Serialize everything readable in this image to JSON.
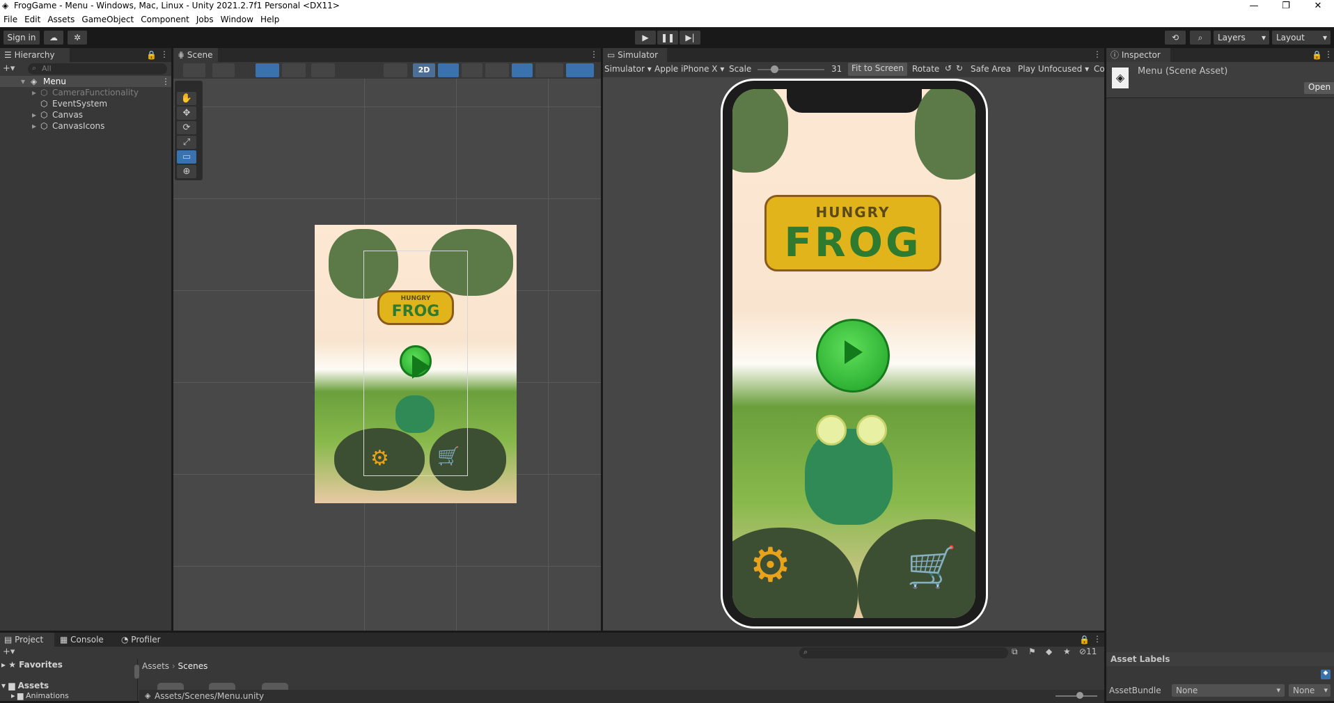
{
  "window": {
    "title": "FrogGame - Menu - Windows, Mac, Linux - Unity 2021.2.7f1 Personal <DX11>",
    "minimize": "—",
    "maximize": "❐",
    "close": "✕"
  },
  "menu": [
    "File",
    "Edit",
    "Assets",
    "GameObject",
    "Component",
    "Jobs",
    "Window",
    "Help"
  ],
  "toolbar": {
    "sign_in": "Sign in",
    "layers": "Layers",
    "layout": "Layout"
  },
  "hierarchy": {
    "tab": "Hierarchy",
    "search_placeholder": "All",
    "scene": "Menu",
    "items": [
      "CameraFunctionality",
      "EventSystem",
      "Canvas",
      "CanvasIcons"
    ]
  },
  "scene": {
    "tab": "Scene",
    "mode_2d": "2D"
  },
  "simulator": {
    "tab": "Simulator",
    "mode": "Simulator",
    "device": "Apple iPhone X",
    "scale_label": "Scale",
    "scale_value": "31",
    "fit": "Fit to Screen",
    "rotate": "Rotate",
    "safe_area": "Safe Area",
    "play_mode": "Play Unfocused",
    "extra": "Co"
  },
  "game": {
    "logo_line1": "HUNGRY",
    "logo_line2": "FROG",
    "settings_icon": "⚙",
    "cart_icon": "🛒"
  },
  "inspector": {
    "tab": "Inspector",
    "asset_name": "Menu (Scene Asset)",
    "open": "Open",
    "asset_labels": "Asset Labels",
    "asset_bundle_label": "AssetBundle",
    "asset_bundle_value": "None",
    "asset_bundle_variant": "None"
  },
  "project": {
    "tabs": [
      "Project",
      "Console",
      "Profiler"
    ],
    "favorites": "Favorites",
    "assets": "Assets",
    "animations": "Animations",
    "breadcrumb_root": "Assets",
    "breadcrumb_current": "Scenes",
    "hidden_count": "11",
    "path": "Assets/Scenes/Menu.unity"
  },
  "colors": {
    "editor_dark": "#191919",
    "panel": "#383838",
    "scene_bg": "#484848",
    "accent_blue": "#3a72b0"
  }
}
